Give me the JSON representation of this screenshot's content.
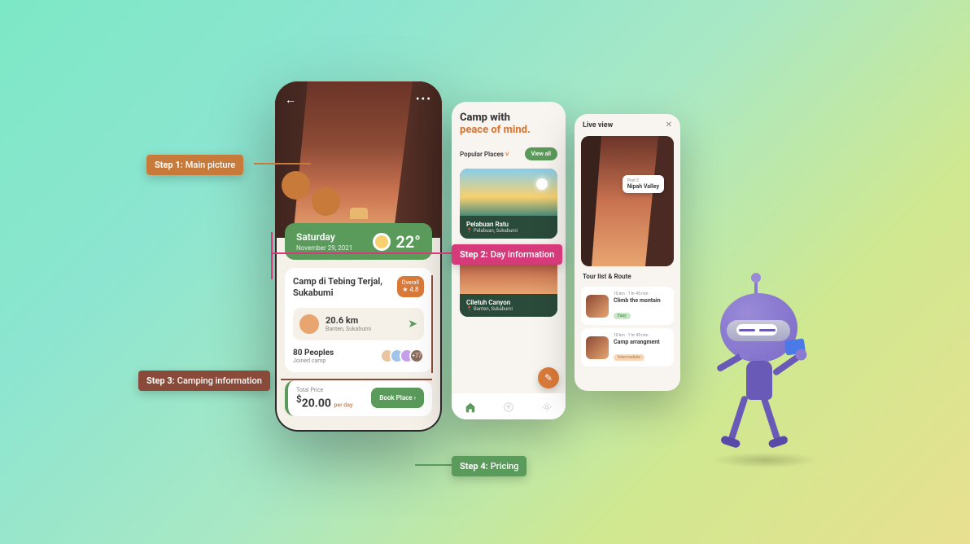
{
  "steps": {
    "s1": {
      "label": "Step 1:",
      "text": "Main picture"
    },
    "s2": {
      "label": "Step 2:",
      "text": "Day information"
    },
    "s3": {
      "label": "Step 3:",
      "text": "Camping information"
    },
    "s4": {
      "label": "Step 4:",
      "text": "Pricing"
    }
  },
  "phone1": {
    "back": "←",
    "more": "•••",
    "weather": {
      "day": "Saturday",
      "date": "November 29, 2021",
      "temp": "22°"
    },
    "camp": {
      "title": "Camp di Tebing Terjal, Sukabumi",
      "rating_label": "Overall",
      "rating": "★ 4.8",
      "distance": "20.6 km",
      "location": "Banten, Sukabumi",
      "nav_icon": "➤"
    },
    "people": {
      "count": "80 Peoples",
      "sub": "Joined camp",
      "more": "+77"
    },
    "price": {
      "label": "Total Price",
      "currency": "$",
      "amount": "20.00",
      "per": "per day",
      "cta": "Book Place  ›"
    }
  },
  "phone2": {
    "headline1": "Camp with",
    "headline2": "peace of mind.",
    "popular": "Popular Places",
    "viewall": "View all",
    "place1": {
      "name": "Pelabuan Ratu",
      "loc": "📍 Pelabuan, Sukabumi"
    },
    "place2": {
      "name": "Ciletuh Canyon",
      "loc": "📍 Banten, Sukabumi"
    },
    "fab": "✎"
  },
  "phone3": {
    "title": "Live view",
    "close": "✕",
    "marker": {
      "label": "Post 2",
      "value": "Nipah Valley"
    },
    "section": "Tour list & Route",
    "tour1": {
      "meta": "10 km  ·  1 hr 45 min",
      "title": "Climb the montain",
      "diff": "Easy"
    },
    "tour2": {
      "meta": "10 km  ·  1 hr 45 min",
      "title": "Camp arrangment",
      "diff": "Intermediate"
    }
  }
}
